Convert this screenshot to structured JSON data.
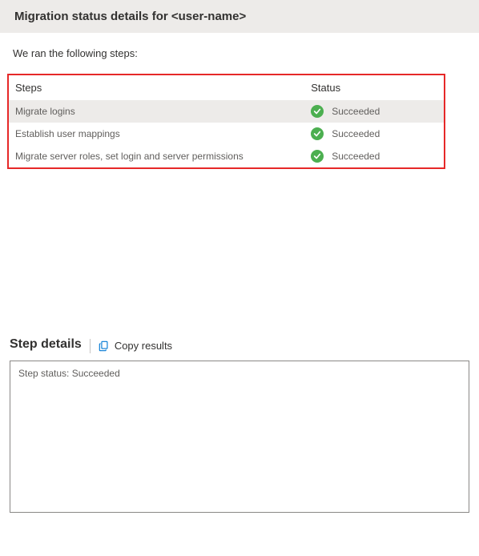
{
  "header": {
    "title": "Migration status details for <user-name>"
  },
  "intro": "We ran the following steps:",
  "table": {
    "columns": {
      "steps": "Steps",
      "status": "Status"
    },
    "rows": [
      {
        "step": "Migrate logins",
        "status": "Succeeded",
        "icon": "success"
      },
      {
        "step": "Establish user mappings",
        "status": "Succeeded",
        "icon": "success"
      },
      {
        "step": "Migrate server roles, set login and server permissions",
        "status": "Succeeded",
        "icon": "success"
      }
    ]
  },
  "details": {
    "title": "Step details",
    "copy_label": "Copy results",
    "status_text": "Step status: Succeeded"
  },
  "colors": {
    "highlight_border": "#e62828",
    "success_green": "#4caf50",
    "link_blue": "#0078d4"
  }
}
